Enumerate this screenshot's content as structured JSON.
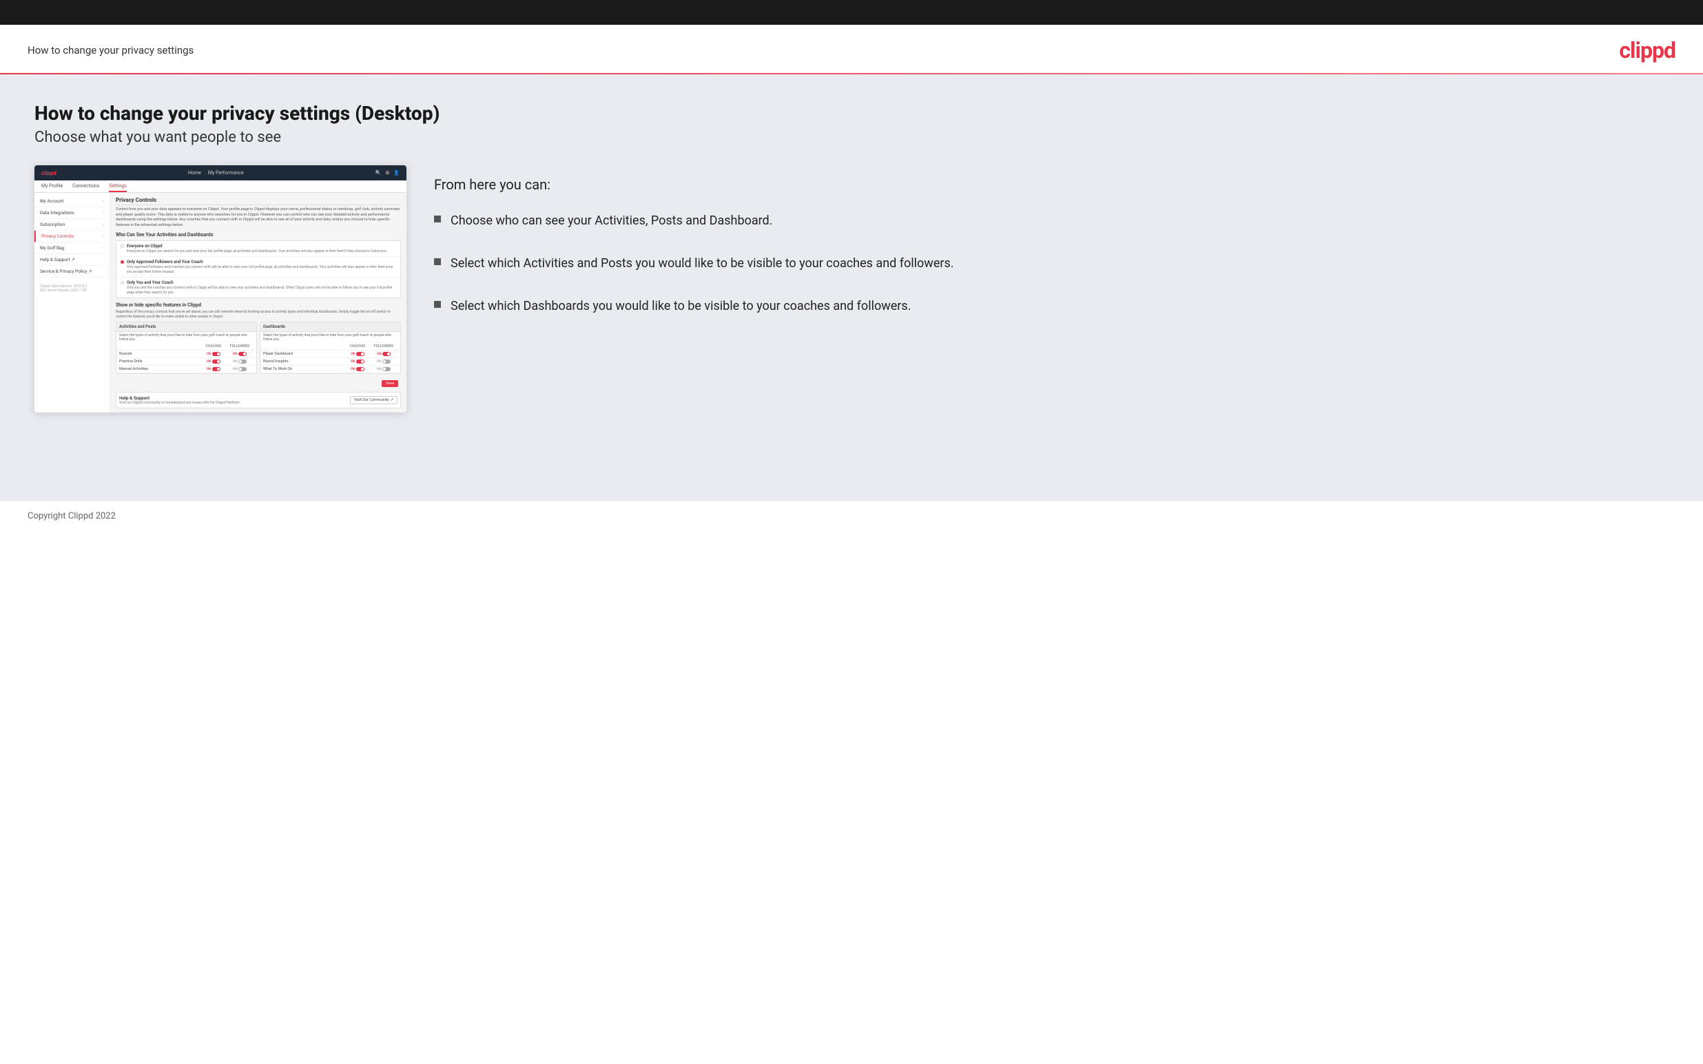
{
  "topbar": {
    "bg": "#1a1a1a"
  },
  "header": {
    "title": "How to change your privacy settings",
    "logo": "clippd"
  },
  "divider": {},
  "main": {
    "title": "How to change your privacy settings (Desktop)",
    "subtitle": "Choose what you want people to see",
    "from_here_label": "From here you can:",
    "bullets": [
      {
        "text": "Choose who can see your Activities, Posts and Dashboard."
      },
      {
        "text": "Select which Activities and Posts you would like to be visible to your coaches and followers."
      },
      {
        "text": "Select which Dashboards you would like to be visible to your coaches and followers."
      }
    ]
  },
  "mockup": {
    "logo": "clippd",
    "nav": {
      "home": "Home",
      "my_performance": "My Performance"
    },
    "subnav": {
      "my_profile": "My Profile",
      "connections": "Connections",
      "settings": "Settings"
    },
    "sidebar": {
      "items": [
        {
          "label": "My Account",
          "active": false
        },
        {
          "label": "Data Integrations",
          "active": false
        },
        {
          "label": "Subscription",
          "active": false
        },
        {
          "label": "Privacy Controls",
          "active": true
        },
        {
          "label": "My Golf Bag",
          "active": false
        },
        {
          "label": "Help & Support",
          "active": false
        },
        {
          "label": "Service & Privacy Policy",
          "active": false
        }
      ],
      "version": "Clippd Client Version: 2022.8.2\nSQL Server Version: 2022.7.38"
    },
    "privacy_controls": {
      "section_title": "Privacy Controls",
      "description": "Control how you and your data appears to everyone on Clippd. Your profile page in Clippd displays your name, professional status or handicap, golf club, activity summary and player quality score. This data is visible to anyone who searches for you in Clippd. However you can control who can see your detailed activity and performance dashboards using the settings below. Any coaches that you connect with in Clippd will be able to see all of your activity and data, unless you choose to hide specific features in the advanced settings below.",
      "who_title": "Who Can See Your Activities and Dashboards",
      "radio_options": [
        {
          "label": "Everyone on Clippd",
          "description": "Everyone on Clippd can search for you and view your full profile page, all activities and dashboards. Your activities will also appear in their feed if they choose to follow you.",
          "selected": false
        },
        {
          "label": "Only Approved Followers and Your Coach",
          "description": "Only approved followers and coaches you connect with will be able to view your full profile page, all activities and dashboards. Your activities will also appear in their feed once you accept their follow request.",
          "selected": true
        },
        {
          "label": "Only You and Your Coach",
          "description": "Only you and the coaches you connect with in Clippd will be able to view your activities and dashboards. Other Clippd users will not be able to follow you or see your full profile page when they search for you.",
          "selected": false
        }
      ],
      "show_hide_title": "Show or hide specific features in Clippd",
      "show_hide_desc": "Regardless of the privacy controls that you've set above, you can still override these by limiting access to activity types and individual dashboards. Simply toggle the on/off switch to control the features you'd like to make visible to other people in Clippd.",
      "activities_table": {
        "header": "Activities and Posts",
        "description": "Select the types of activity that you'd like to hide from your golf coach or people who follow you.",
        "col_coaches": "COACHES",
        "col_followers": "FOLLOWERS",
        "rows": [
          {
            "label": "Rounds",
            "coaches_on": true,
            "followers_on": true
          },
          {
            "label": "Practice Drills",
            "coaches_on": true,
            "followers_off": true
          },
          {
            "label": "Manual Activities",
            "coaches_on": true,
            "followers_off": true
          }
        ]
      },
      "dashboards_table": {
        "header": "Dashboards",
        "description": "Select the types of activity that you'd like to hide from your golf coach or people who follow you.",
        "col_coaches": "COACHES",
        "col_followers": "FOLLOWERS",
        "rows": [
          {
            "label": "Player Dashboard",
            "coaches_on": true,
            "followers_on": true
          },
          {
            "label": "Round Insights",
            "coaches_on": true,
            "followers_on": false
          },
          {
            "label": "What To Work On",
            "coaches_on": true,
            "followers_on": false
          }
        ]
      },
      "save_btn": "Save",
      "help_section": {
        "title": "Help & Support",
        "desc": "Visit our Clippd community to troubleshoot any issues with the Clippd Platform.",
        "btn": "Visit Our Community"
      }
    }
  },
  "footer": {
    "copyright": "Copyright Clippd 2022"
  }
}
